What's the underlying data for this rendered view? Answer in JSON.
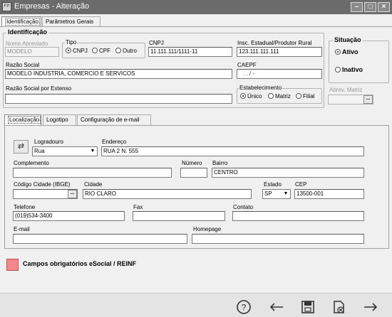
{
  "window": {
    "title": "Empresas - Alteração",
    "app_icon": "FP"
  },
  "main_tabs": [
    {
      "label": "Identificação",
      "active": true
    },
    {
      "label": "Parâmetros Gerais",
      "active": false
    }
  ],
  "identificacao": {
    "group_title": "Identificação",
    "nome_abreviado": {
      "label": "Nome Abreviado",
      "value": "MODELO"
    },
    "tipo": {
      "label": "Tipo",
      "options": [
        "CNPJ",
        "CPF",
        "Outro"
      ],
      "selected": "CNPJ"
    },
    "cnpj": {
      "label": "CNPJ",
      "value": "11.111.111/1111-11"
    },
    "insc_estadual": {
      "label": "Insc. Estadual/Produtor Rural",
      "value": "123.111.111.111"
    },
    "razao_social": {
      "label": "Razão Social",
      "value": "MODELO INDUSTRIA, COMERCIO E SERVICOS"
    },
    "caepf": {
      "label": "CAEPF",
      "value": ". . / -"
    },
    "razao_extenso": {
      "label": "Razão Social por Extenso",
      "value": ""
    },
    "estabelecimento": {
      "label": "Estabelecimento",
      "options": [
        "Único",
        "Matriz",
        "Filial"
      ],
      "selected": "Único"
    },
    "abrev_matriz": {
      "label": "Abrev. Matriz",
      "value": ""
    }
  },
  "situacao": {
    "title": "Situação",
    "options": [
      "Ativo",
      "Inativo"
    ],
    "selected": "Ativo"
  },
  "sub_tabs": [
    {
      "label": "Localização",
      "active": true
    },
    {
      "label": "Logotipo",
      "active": false
    },
    {
      "label": "Configuração de e-mail",
      "active": false
    }
  ],
  "localizacao": {
    "logradouro": {
      "label": "Logradouro",
      "value": "Rua"
    },
    "endereco": {
      "label": "Endereço",
      "value": "RUA 2 N. 555"
    },
    "complemento": {
      "label": "Complemento",
      "value": ""
    },
    "numero": {
      "label": "Número",
      "value": ""
    },
    "bairro": {
      "label": "Bairro",
      "value": "CENTRO"
    },
    "codigo_cidade": {
      "label": "Código Cidade (IBGE)",
      "value": ""
    },
    "cidade": {
      "label": "Cidade",
      "value": "RIO CLARO"
    },
    "estado": {
      "label": "Estado",
      "value": "SP"
    },
    "cep": {
      "label": "CEP",
      "value": "13500-001"
    },
    "telefone": {
      "label": "Telefone",
      "value": "(019)534-3400"
    },
    "fax": {
      "label": "Fax",
      "value": ""
    },
    "contato": {
      "label": "Contato",
      "value": ""
    },
    "email": {
      "label": "E-mail",
      "value": ""
    },
    "homepage": {
      "label": "Homepage",
      "value": ""
    }
  },
  "legend": {
    "text": "Campos obrigatórios eSocial / REINF",
    "color": "#f3878b"
  },
  "footer_icons": [
    "help-icon",
    "back-arrow-icon",
    "save-icon",
    "delete-icon",
    "forward-arrow-icon"
  ],
  "colors": {
    "titlebar": "#6b6b6b",
    "background": "#f0f0f0",
    "required": "#f3878b"
  }
}
